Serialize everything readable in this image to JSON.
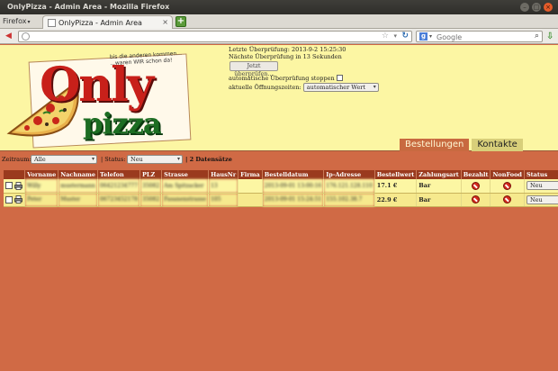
{
  "window": {
    "title": "OnlyPizza - Admin Area - Mozilla Firefox",
    "app_menu": "Firefox"
  },
  "tab": {
    "title": "OnlyPizza - Admin Area"
  },
  "urlbar": {
    "value": ""
  },
  "search": {
    "engine": "Google",
    "placeholder": "Google"
  },
  "logo": {
    "tagline_1": "bis die anderen kommen...",
    "tagline_2": "...waren WIR schon da!",
    "word_1": "Only",
    "word_2": "pizza"
  },
  "status": {
    "last_check": "Letzte Überprüfung: 2013-9-2 15:25:30",
    "next_check": "Nächste Überprüfung in 13 Sekunden",
    "check_now_button": "Jetzt überprüfen...",
    "stop_label": "automatische Überprüfung stoppen",
    "interval_label": "aktuelle Öffnungszeiten:",
    "interval_value": "automatischer Wert"
  },
  "nav": {
    "orders_tab": "Bestellungen",
    "contacts_tab": "Kontakte"
  },
  "filter": {
    "period_label": "Zeitraum:",
    "period_value": "Alle",
    "status_label": "| Status:",
    "status_value": "Neu",
    "count_text": "| 2 Datensätze"
  },
  "table": {
    "headers": [
      "",
      "Vorname",
      "Nachname",
      "Telefon",
      "PLZ",
      "Strasse",
      "HausNr",
      "Firma",
      "Bestelldatum",
      "Ip-Adresse",
      "Bestellwert",
      "Zahlungsart",
      "Bezahlt",
      "NonFood",
      "Status"
    ],
    "rows": [
      {
        "vorname": "Willy",
        "nachname": "mustermann",
        "telefon": "06421234777",
        "plz": "35082",
        "strasse": "Am Spitzacker",
        "hausnr": "13",
        "firma": "",
        "datum": "2013-09-01 13:00:16",
        "ip": "176.121.128.110",
        "wert": "17.1 €",
        "zahlung": "Bar",
        "status": "Neu"
      },
      {
        "vorname": "Peter",
        "nachname": "Muster",
        "telefon": "06723452178",
        "plz": "35082",
        "strasse": "Fasanenstrasse",
        "hausnr": "105",
        "firma": "",
        "datum": "2013-09-01 15:24:51",
        "ip": "155.102.38.7",
        "wert": "22.9 €",
        "zahlung": "Bar",
        "status": "Neu"
      }
    ]
  }
}
